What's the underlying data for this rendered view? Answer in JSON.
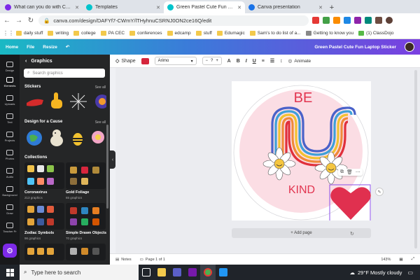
{
  "browser": {
    "tabs": [
      {
        "title": "What can you do with Canva EC",
        "fav_color": "#7d2ae8"
      },
      {
        "title": "Templates",
        "fav_color": "#00c4cc"
      },
      {
        "title": "Green Pastel Cute Fun Laptop St",
        "fav_color": "#00c4cc"
      },
      {
        "title": "Canva presentation",
        "fav_color": "#1a73e8"
      }
    ],
    "new_tab": "+",
    "url": "canva.com/design/DAFYf7-CWmY/lTHyhnuCSRNJ0ON2ce16Q/edit",
    "bookmarks": [
      "daily stuff",
      "writing",
      "college",
      "PA CEC",
      "conferences",
      "edcamp",
      "stuff",
      "Edumagic",
      "Sam's to do list of a...",
      "Getting to know you",
      "(1) ClassDojo"
    ]
  },
  "canva": {
    "menu": [
      "Home",
      "File",
      "Resize"
    ],
    "doc_title": "Green Pastel Cute Fun Laptop Sticker",
    "rail": [
      "Design",
      "Elements",
      "Uploads",
      "Text",
      "Projects",
      "Photos",
      "Audio",
      "Background",
      "Draw",
      "Teacher Pr"
    ],
    "panel": {
      "title": "Graphics",
      "search_placeholder": "Search graphics",
      "sections": {
        "stickers": "Stickers",
        "cause": "Design for a Cause",
        "collections": "Collections"
      },
      "see_all": "See all",
      "collections": [
        {
          "name": "Coronavirus",
          "count": "213 graphics"
        },
        {
          "name": "Gold Foliage",
          "count": "65 graphics"
        },
        {
          "name": "Zodiac Symbols",
          "count": "96 graphics"
        },
        {
          "name": "Simple Drawn Objects",
          "count": "70 graphics"
        }
      ]
    },
    "toolbar": {
      "shape_label": "Shape",
      "font": "Arimo",
      "size": "?",
      "bold": "B",
      "italic": "I",
      "underline": "U",
      "animate": "Animate"
    },
    "design": {
      "word_top": "BE",
      "word_bottom": "KIND",
      "accent": "#d5253c"
    },
    "add_page": "+ Add page",
    "footer": {
      "notes": "Notes",
      "page": "Page 1 of 1",
      "zoom": "143%"
    }
  },
  "taskbar": {
    "search_placeholder": "Type here to search",
    "weather": "29°F  Mostly cloudy"
  }
}
